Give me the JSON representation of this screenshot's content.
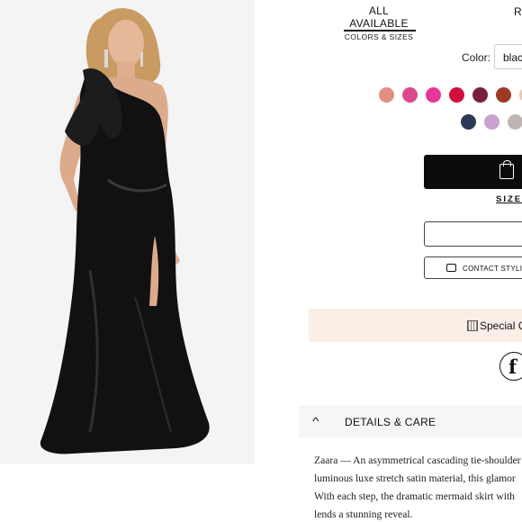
{
  "tabs": {
    "active_title": "ALL AVAILABLE",
    "active_subtitle": "COLORS & SIZES",
    "next_tab_partial": "R"
  },
  "color": {
    "label": "Color:",
    "selected_value": "blac"
  },
  "swatches": [
    {
      "color": "#e08f82"
    },
    {
      "color": "#d94b8c"
    },
    {
      "color": "#e8359a"
    },
    {
      "color": "#d20f3c"
    },
    {
      "color": "#76203e"
    },
    {
      "color": "#9c3a24"
    },
    {
      "color": "#f0c4a8"
    },
    {
      "color": "#2a3a57"
    },
    {
      "color": "#c9a2cd"
    },
    {
      "color": "#bfb6b4"
    }
  ],
  "buttons": {
    "size_link": "SIZE",
    "contact_stylist": "CONTACT STYLIS"
  },
  "promo": {
    "text": "Special O"
  },
  "details": {
    "header": "DETAILS & CARE",
    "description_lines": [
      "Zaara — An asymmetrical cascading tie-shoulder",
      "luminous luxe stretch satin material, this glamor",
      "With each step, the dramatic mermaid skirt with",
      "lends a stunning reveal."
    ]
  },
  "colors": {
    "primary_button": "#0c0c0c",
    "promo_background": "#fbeee6",
    "details_background": "#f6f6f6",
    "photo_background": "#f4f4f4"
  }
}
